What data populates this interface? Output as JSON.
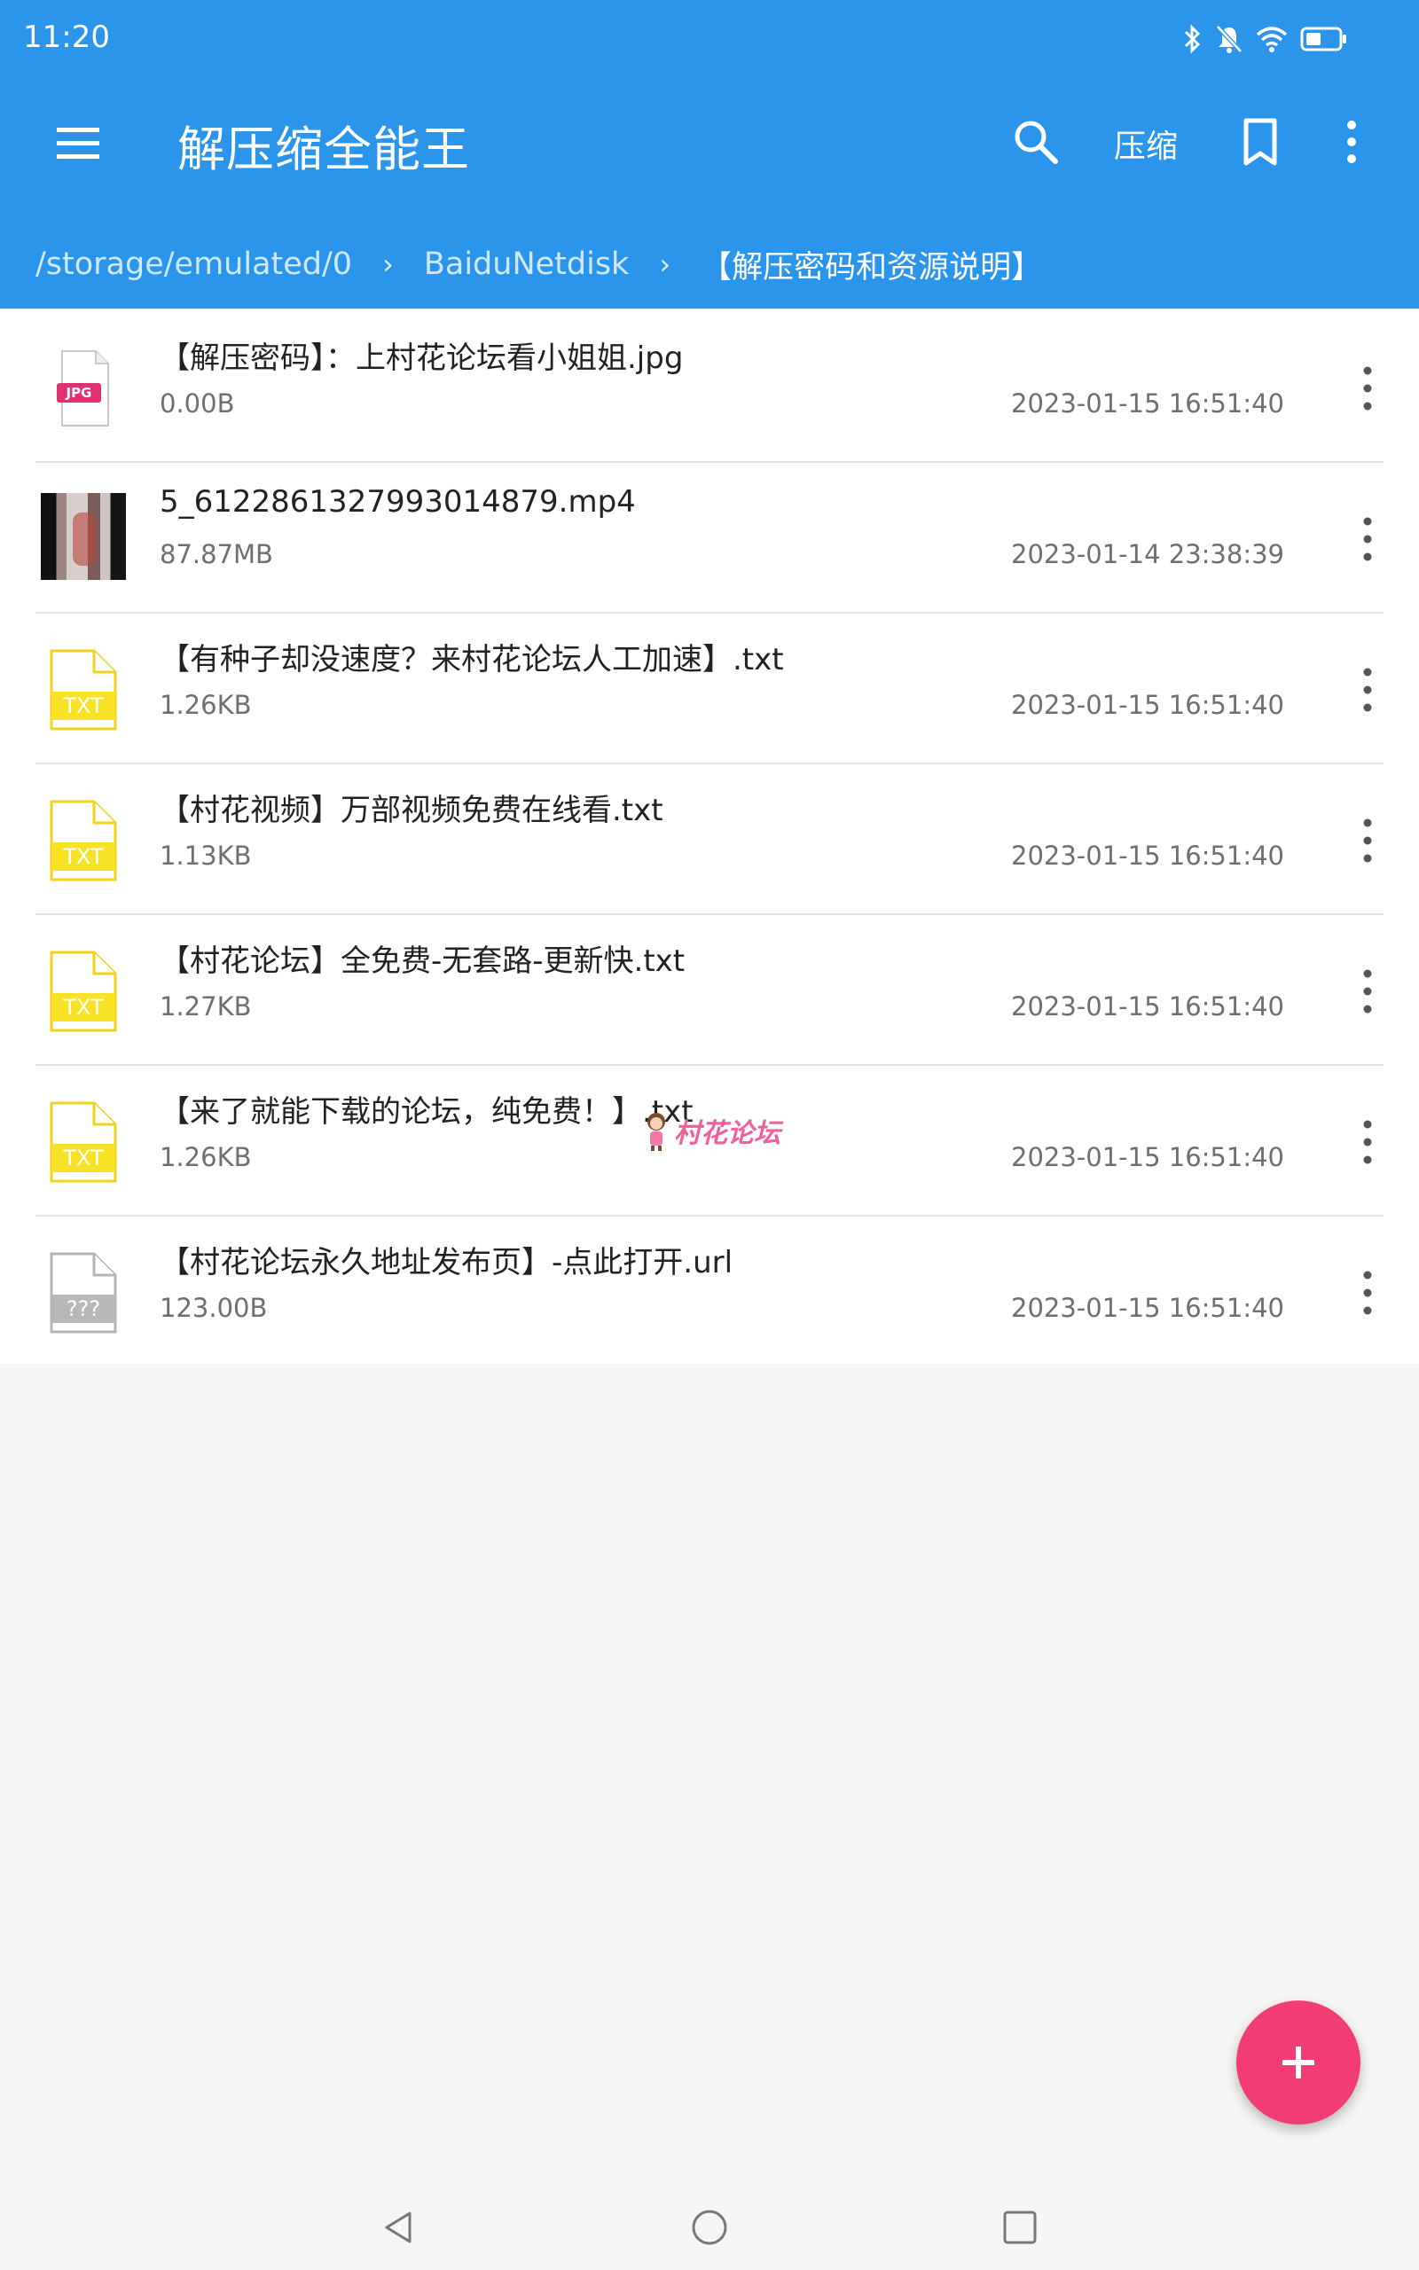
{
  "status_bar": {
    "time": "11:20"
  },
  "app": {
    "title": "解压缩全能王",
    "compress_label": "压缩",
    "accent_color": "#2b95ec",
    "fab_color": "#f23d74"
  },
  "breadcrumb": [
    {
      "label": "/storage/emulated/0"
    },
    {
      "label": "BaiduNetdisk"
    },
    {
      "label": "【解压密码和资源说明】"
    }
  ],
  "files": [
    {
      "name": "【解压密码】：上村花论坛看小姐姐.jpg",
      "size": "0.00B",
      "date": "2023-01-15 16:51:40",
      "icon": "jpg-file-icon",
      "icon_label": "JPG"
    },
    {
      "name": "5_6122861327993014879.mp4",
      "size": "87.87MB",
      "date": "2023-01-14 23:38:39",
      "icon": "video-thumbnail"
    },
    {
      "name": "【有种子却没速度？来村花论坛人工加速】.txt",
      "size": "1.26KB",
      "date": "2023-01-15 16:51:40",
      "icon": "txt-file-icon",
      "icon_label": "TXT"
    },
    {
      "name": "【村花视频】万部视频免费在线看.txt",
      "size": "1.13KB",
      "date": "2023-01-15 16:51:40",
      "icon": "txt-file-icon",
      "icon_label": "TXT"
    },
    {
      "name": "【村花论坛】全免费-无套路-更新快.txt",
      "size": "1.27KB",
      "date": "2023-01-15 16:51:40",
      "icon": "txt-file-icon",
      "icon_label": "TXT"
    },
    {
      "name": "【来了就能下载的论坛，纯免费！】.txt",
      "size": "1.26KB",
      "date": "2023-01-15 16:51:40",
      "icon": "txt-file-icon",
      "icon_label": "TXT"
    },
    {
      "name": "【村花论坛永久地址发布页】-点此打开.url",
      "size": "123.00B",
      "date": "2023-01-15 16:51:40",
      "icon": "unknown-file-icon",
      "icon_label": "???"
    }
  ],
  "watermark": {
    "text": "村花论坛"
  }
}
